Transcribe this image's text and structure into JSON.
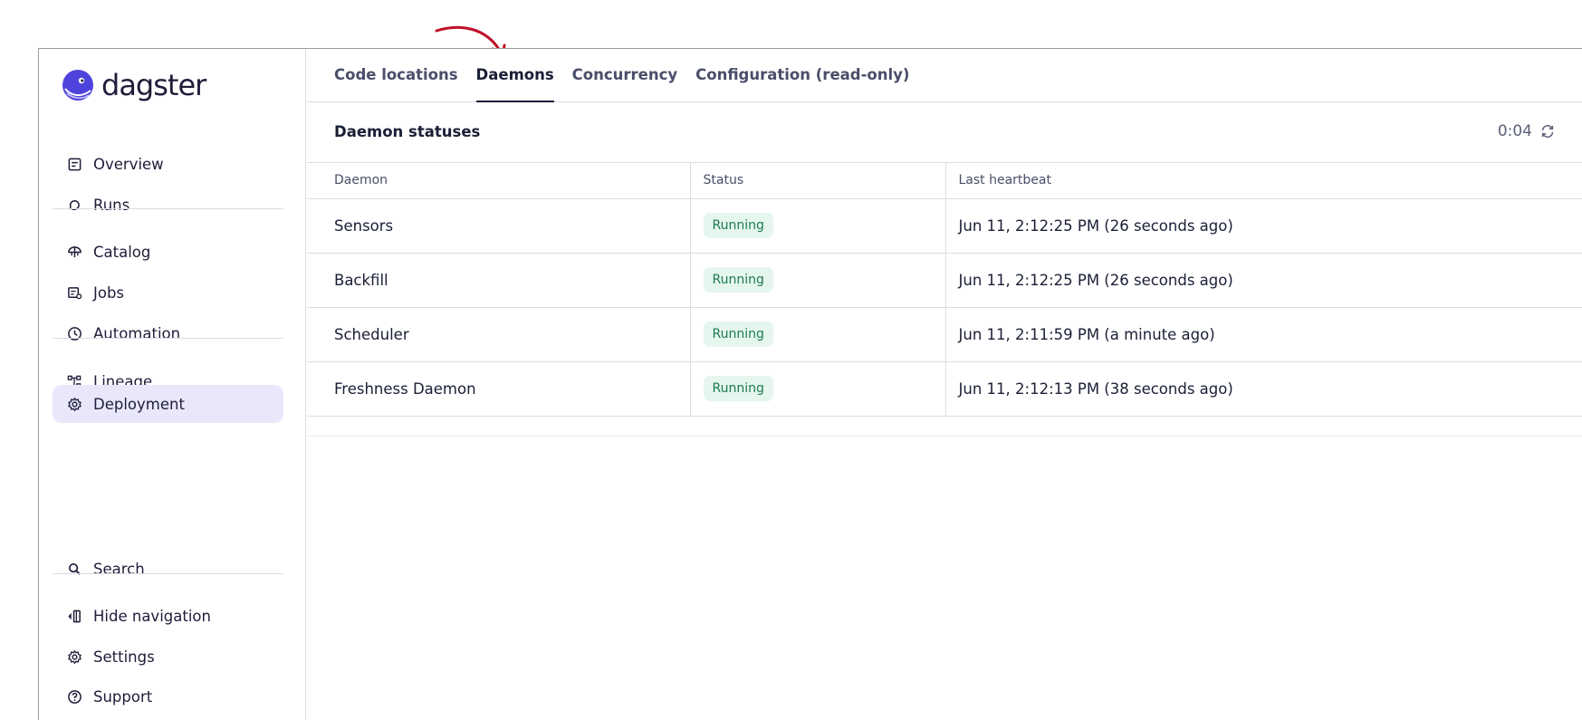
{
  "app": {
    "logo_text": "dagster"
  },
  "sidebar": {
    "items": [
      {
        "label": "Overview",
        "icon": "overview-icon"
      },
      {
        "label": "Runs",
        "icon": "runs-icon"
      },
      {
        "label": "Catalog",
        "icon": "catalog-icon"
      },
      {
        "label": "Jobs",
        "icon": "jobs-icon"
      },
      {
        "label": "Automation",
        "icon": "automation-icon"
      },
      {
        "label": "Lineage",
        "icon": "lineage-icon"
      },
      {
        "label": "Deployment",
        "icon": "gear-icon",
        "active": true
      }
    ],
    "bottom_items": [
      {
        "label": "Search",
        "icon": "search-icon"
      },
      {
        "label": "Hide navigation",
        "icon": "hide-navigation-icon"
      },
      {
        "label": "Settings",
        "icon": "gear-icon"
      },
      {
        "label": "Support",
        "icon": "help-icon"
      }
    ]
  },
  "tabs": [
    {
      "label": "Code locations"
    },
    {
      "label": "Daemons",
      "active": true
    },
    {
      "label": "Concurrency"
    },
    {
      "label": "Configuration (read-only)"
    }
  ],
  "section": {
    "title": "Daemon statuses",
    "refresh_countdown": "0:04"
  },
  "table": {
    "headers": [
      "Daemon",
      "Status",
      "Last heartbeat"
    ],
    "rows": [
      {
        "daemon": "Sensors",
        "status": "Running",
        "heartbeat": "Jun 11, 2:12:25 PM (26 seconds ago)"
      },
      {
        "daemon": "Backfill",
        "status": "Running",
        "heartbeat": "Jun 11, 2:12:25 PM (26 seconds ago)"
      },
      {
        "daemon": "Scheduler",
        "status": "Running",
        "heartbeat": "Jun 11, 2:11:59 PM (a minute ago)"
      },
      {
        "daemon": "Freshness Daemon",
        "status": "Running",
        "heartbeat": "Jun 11, 2:12:13 PM (38 seconds ago)"
      }
    ]
  },
  "colors": {
    "active_nav_bg": "#e9e8fb",
    "running_badge_bg": "#e5f6ef",
    "running_badge_text": "#1e7a4e",
    "annotation_arrow": "#c0102a",
    "logo": "#4f43dd"
  }
}
